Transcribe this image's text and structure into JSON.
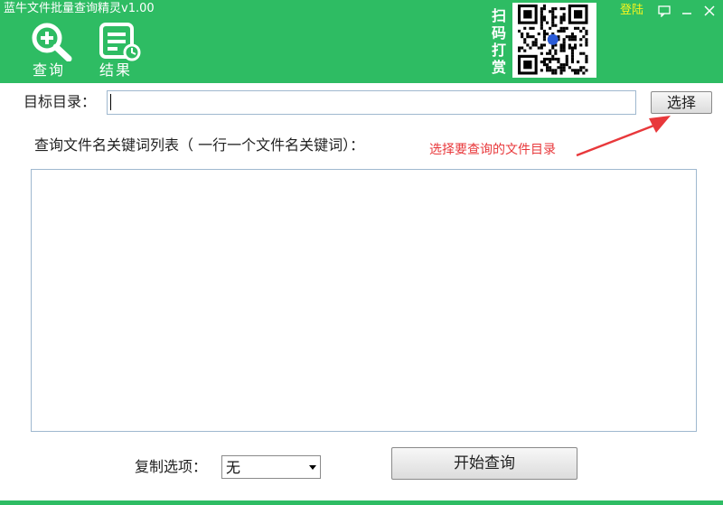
{
  "window": {
    "title": "蓝牛文件批量查询精灵v1.00",
    "login_label": "登陆",
    "controls": [
      "comment-icon",
      "minimize-icon",
      "close-icon"
    ]
  },
  "toolbar": {
    "query_label": "查询",
    "result_label": "结果",
    "query_icon": "zoom-in-icon",
    "result_icon": "document-clock-icon"
  },
  "donate": {
    "text": "扫码打赏",
    "qr_icon": "qr-code-icon"
  },
  "form": {
    "target_dir_label": "目标目录：",
    "target_dir_value": "",
    "browse_button": "选择",
    "keywords_label": "查询文件名关键词列表（ 一行一个文件名关键词）：",
    "keywords_value": "",
    "annotation": "选择要查询的文件目录",
    "copy_option_label": "复制选项：",
    "copy_option_value": "无",
    "start_button": "开始查询"
  },
  "colors": {
    "header_green": "#2ebc63",
    "annotation_red": "#e8383b",
    "login_yellow": "#f5f51e"
  }
}
